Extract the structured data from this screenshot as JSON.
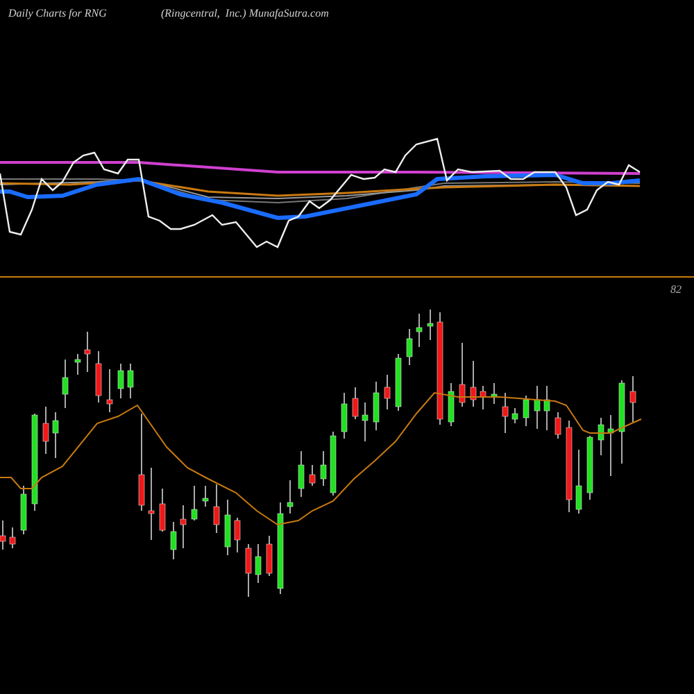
{
  "header": {
    "title": "Daily Charts for RNG",
    "source": "(Ringcentral,  Inc.) MunafaSutra.com"
  },
  "price_panel": {
    "axis_label": "82"
  }
}
